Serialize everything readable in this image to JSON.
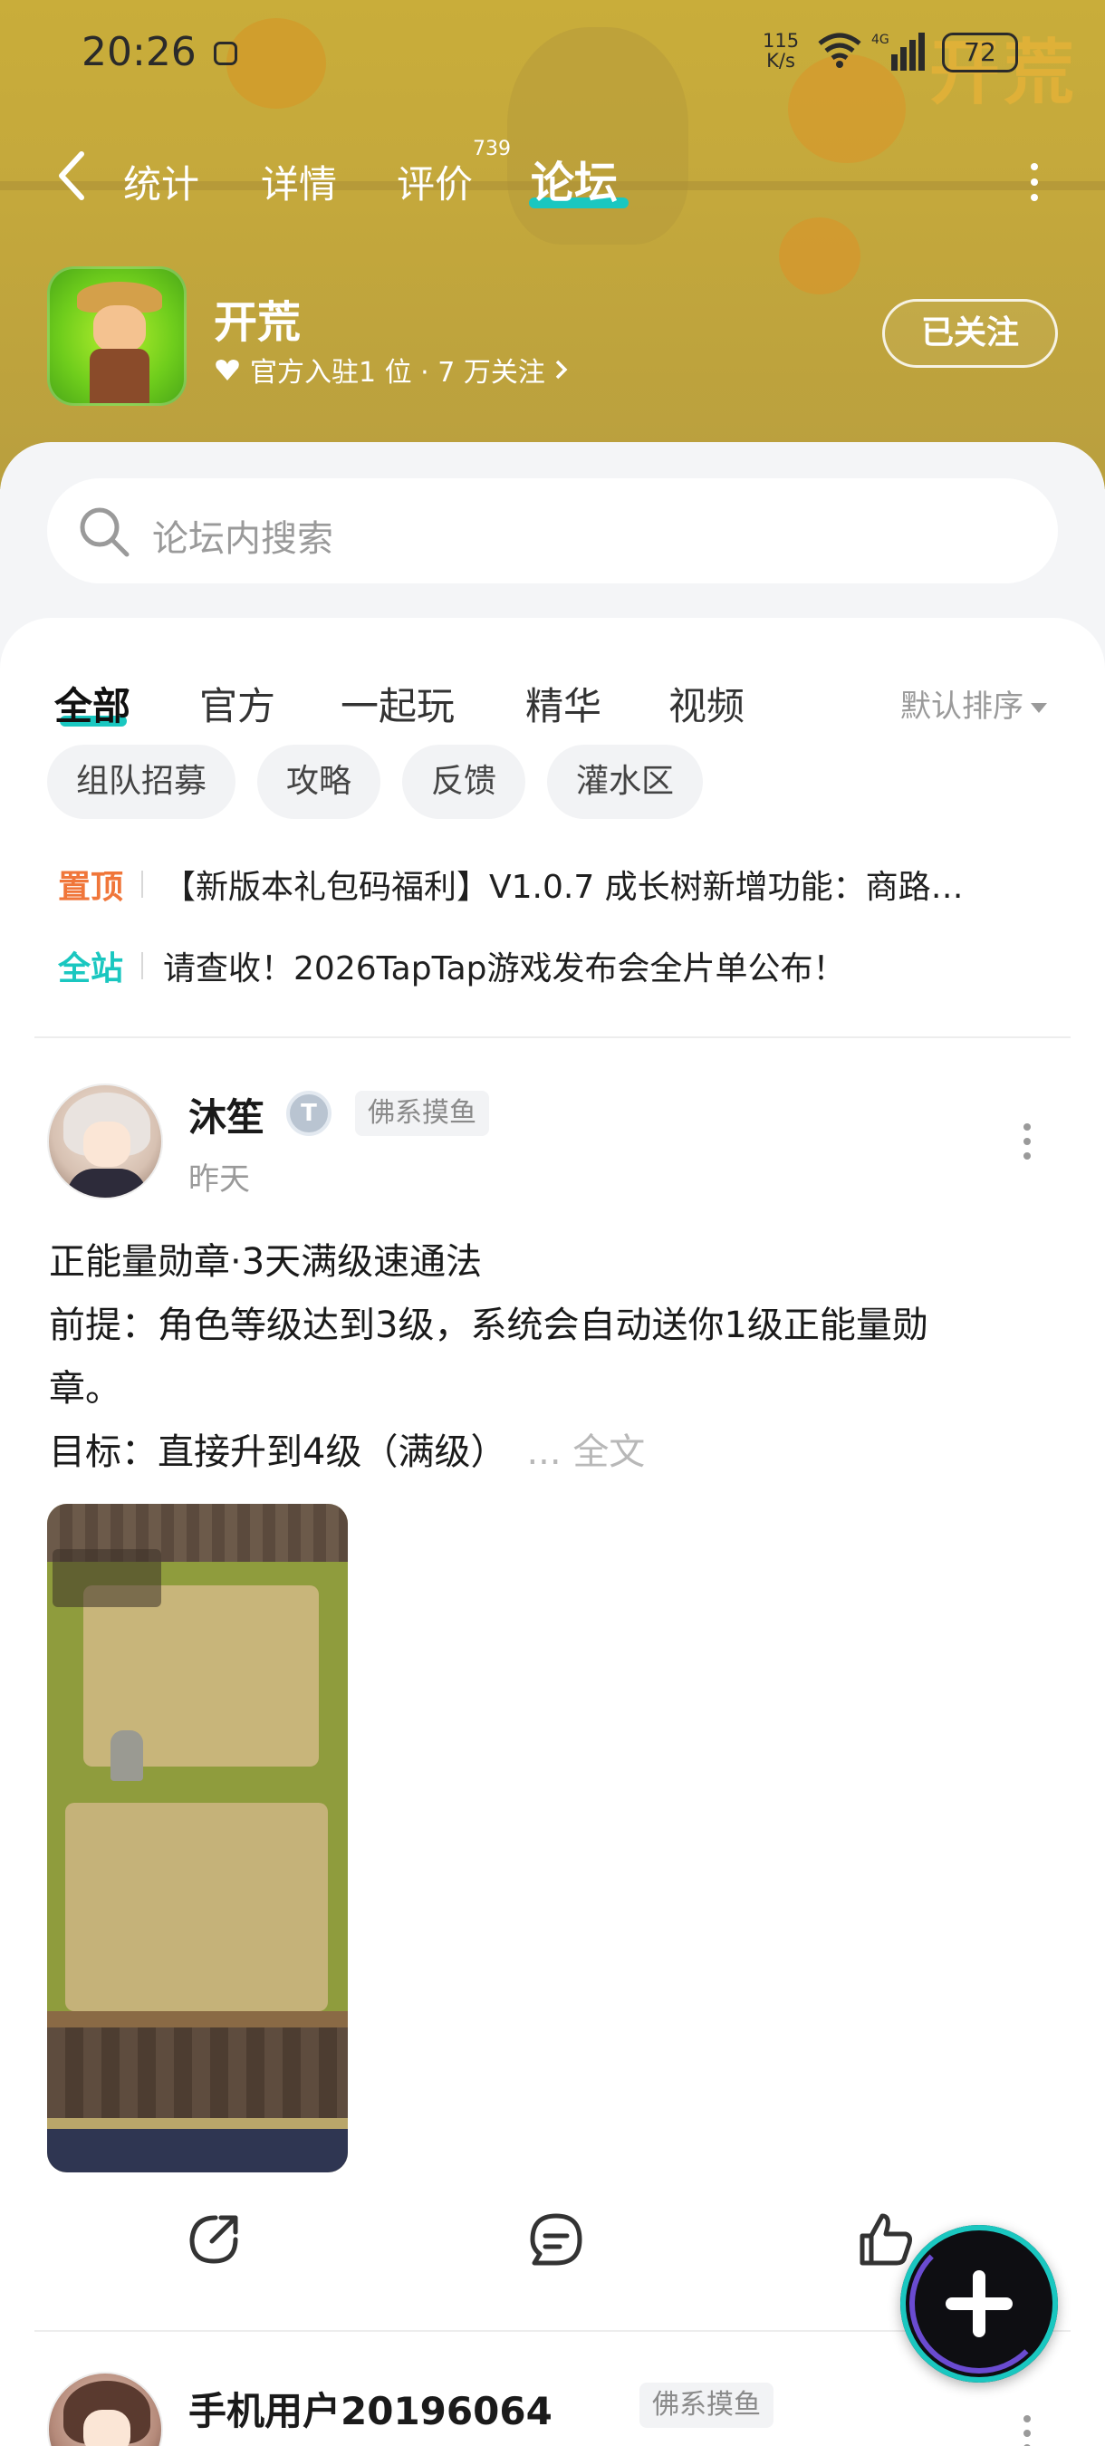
{
  "status_bar": {
    "time": "20:26",
    "speed_value": "115",
    "speed_unit": "K/s",
    "network": "4G",
    "battery": "72"
  },
  "nav": {
    "tabs": [
      {
        "label": "统计"
      },
      {
        "label": "详情"
      },
      {
        "label": "评价"
      },
      {
        "label": "论坛"
      }
    ],
    "active_tab": "论坛",
    "review_count": "739"
  },
  "hero": {
    "art_title": "开荒"
  },
  "app": {
    "name": "开荒",
    "meta": "官方入驻1 位 · 7 万关注",
    "follow_label": "已关注"
  },
  "search": {
    "placeholder": "论坛内搜索"
  },
  "category_tabs": [
    {
      "label": "全部"
    },
    {
      "label": "官方"
    },
    {
      "label": "一起玩"
    },
    {
      "label": "精华"
    },
    {
      "label": "视频"
    }
  ],
  "sort_label": "默认排序",
  "chips": [
    {
      "label": "组队招募"
    },
    {
      "label": "攻略"
    },
    {
      "label": "反馈"
    },
    {
      "label": "灌水区"
    }
  ],
  "pinned": [
    {
      "tag": "置顶",
      "title": "【新版本礼包码福利】V1.0.7 成长树新增功能：商路…"
    },
    {
      "tag": "全站",
      "title": "请查收！2026TapTap游戏发布会全片单公布！"
    }
  ],
  "posts": [
    {
      "user": "沐笙",
      "badge": "佛系摸鱼",
      "time": "昨天",
      "lines": [
        "正能量勋章·3天满级速通法",
        "前提：角色等级达到3级，系统会自动送你1级正能量勋",
        "章。",
        "目标：直接升到4级（满级）"
      ],
      "more": "... 全文"
    },
    {
      "user": "手机用户20196064",
      "badge": "佛系摸鱼"
    }
  ],
  "colors": {
    "accent": "#1ac7c0",
    "pinned_tag": "#f0763a"
  }
}
